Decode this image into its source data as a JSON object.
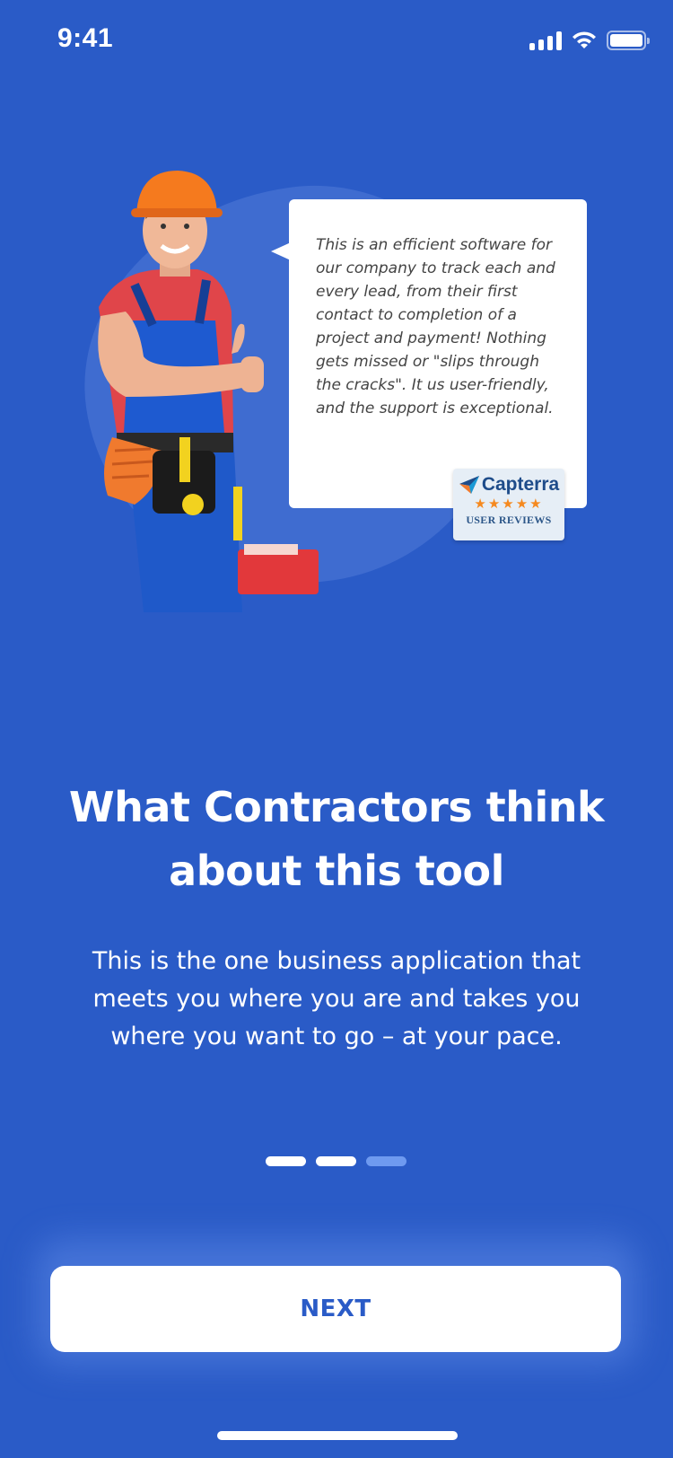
{
  "status_bar": {
    "time": "9:41",
    "icons": [
      "cellular-signal-icon",
      "wifi-icon",
      "battery-icon"
    ]
  },
  "testimonial": {
    "quote": "This is an efficient software for our company to track each and every lead, from their first contact to completion of a project and payment! Nothing gets missed or \"slips through the cracks\". It us user-friendly, and the support is exceptional.",
    "badge": {
      "brand": "Capterra",
      "stars": "★★★★★",
      "rating": 4.5,
      "caption": "USER REVIEWS"
    }
  },
  "onboarding": {
    "title": "What Contractors think about this tool",
    "subtitle": "This is the one business application that meets you where you are and takes you where you want to go – at your pace.",
    "pages_total": 3,
    "current_page": 3
  },
  "actions": {
    "next_label": "NEXT"
  },
  "colors": {
    "background": "#2a5bc7",
    "accent_dot": "#6e9af0",
    "button_bg": "#ffffff",
    "button_text": "#2a5bc7",
    "star": "#f5891f"
  }
}
